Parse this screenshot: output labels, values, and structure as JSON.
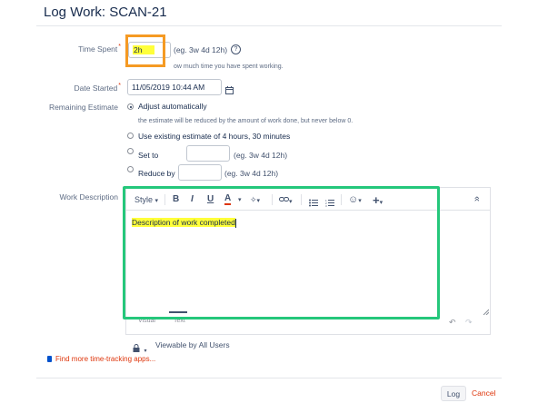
{
  "dialog": {
    "title": "Log Work: SCAN-21"
  },
  "time_spent": {
    "label": "Time Spent",
    "required_mark": "*",
    "value": "2h",
    "example": "(eg. 3w 4d 12h)",
    "help_icon": "question-circle-icon",
    "description": "ow much time you have spent working."
  },
  "date_started": {
    "label": "Date Started",
    "required_mark": "*",
    "value": "11/05/2019 10:44 AM",
    "calendar_icon": "calendar-icon"
  },
  "remaining_estimate": {
    "label": "Remaining Estimate",
    "options": [
      {
        "label": "Adjust automatically",
        "checked": true
      },
      {
        "label": "Use existing estimate of 4 hours, 30 minutes",
        "checked": false
      },
      {
        "label": "Set to",
        "checked": false,
        "example": "(eg. 3w 4d 12h)"
      },
      {
        "label": "Reduce by",
        "checked": false,
        "example": "(eg. 3w 4d 12h)"
      }
    ],
    "auto_note": "the estimate will be reduced by the amount of work done, but never below 0."
  },
  "work_description": {
    "label": "Work Description",
    "toolbar": {
      "style": "Style",
      "bold": "B",
      "italic": "I",
      "underline": "U",
      "text_color": "A",
      "more_format": "✧",
      "link": "🔗",
      "bullet_list": "☰",
      "numbered_list": "☰",
      "emoji": "☺",
      "insert": "+",
      "collapse": "»"
    },
    "content": "Description of work completed",
    "tabs": [
      "Visual",
      "Text"
    ]
  },
  "visibility": {
    "label": "Viewable by All Users",
    "icon": "lock-icon"
  },
  "find_more_link": "Find more time-tracking apps...",
  "buttons": {
    "log": "Log",
    "cancel": "Cancel"
  },
  "colors": {
    "annotation_orange": "#f59a23",
    "annotation_green": "#25c77b",
    "highlight_yellow": "#ffff3a",
    "cancel_red": "#de350b",
    "link_blue": "#0052cc"
  }
}
